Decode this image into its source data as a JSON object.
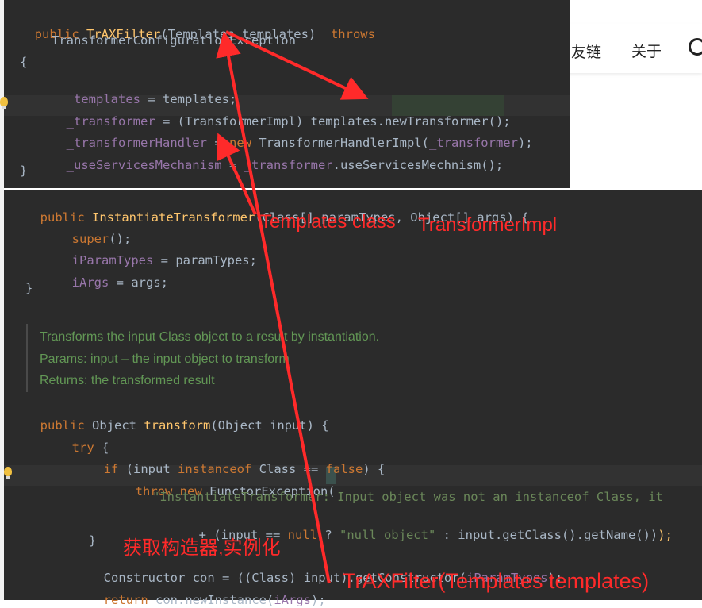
{
  "nav": {
    "link_friends": "友链",
    "link_about": "关于",
    "search_icon": "search-icon"
  },
  "top_code": {
    "line1": {
      "kw": "public ",
      "fn": "TrAXFilter",
      "rest": "(Templates templates)  ",
      "throws": "throws"
    },
    "line2": "TransformerConfigurationException",
    "line3": "{",
    "line4": {
      "fld": "_templates",
      "rest": " = templates;"
    },
    "line5": {
      "fld": "_transformer",
      "rest1": " = (TransformerImpl) templates.",
      "call": "newTransformer",
      "rest2": "();"
    },
    "line6": {
      "fld": "_transformerHandler",
      "eq": " = ",
      "kw": "new",
      "mid": " TransformerHandlerImpl(",
      "arg": "_transformer",
      "end": ");"
    },
    "line7": {
      "fld": "_useServicesMechanism",
      "eq": " = ",
      "obj": "_transformer",
      "rest": ".useServicesMechnism();"
    },
    "line8": "}"
  },
  "bottom_code": {
    "ctor": {
      "kw": "public ",
      "fn": "InstantiateTransformer",
      "rest": "(Class[] paramTypes, Object[] args) {"
    },
    "super": {
      "kw": "super",
      "rest": "();"
    },
    "ptypes": {
      "fld": "iParamTypes",
      "rest": " = paramTypes;"
    },
    "iargs": {
      "fld": "iArgs",
      "rest": " = args;"
    },
    "close1": "}",
    "doc1": "Transforms the input Class object to a result by instantiation.",
    "doc2": "Params: input – the input object to transform",
    "doc3": "Returns: the transformed result",
    "method": {
      "kw": "public ",
      "type": "Object ",
      "fn": "transform",
      "rest": "(Object input) {"
    },
    "try": {
      "kw": "try",
      "rest": " {"
    },
    "if": {
      "kw1": "if",
      "p1": " (input ",
      "kw2": "instanceof",
      "p2": " Class == ",
      "kw3": "false",
      "p3": ") {"
    },
    "throw": {
      "kw1": "throw",
      "kw2": " new",
      "rest": " FunctorException("
    },
    "msg": "\"InstantiateTransformer: Input object was not an instanceof Class, it",
    "plus": {
      "p1": "+ (input == ",
      "kw": "null",
      "p2": " ? ",
      "str": "\"null object\"",
      "p3": " : input.getClass().getName())",
      "end": ");"
    },
    "close2": "}",
    "constructor": {
      "p1": "Constructor con = ((Class) input).getConstructor(",
      "fld": "iParamTypes",
      "p2": ");"
    },
    "ret": {
      "kw": "return",
      "p1": " con.newInstance(",
      "fld": "iArgs",
      "p2": ");"
    }
  },
  "annotations": {
    "templates_class": "Templates class",
    "transformer_impl": "TransformerImpl",
    "get_constructor": "获取构造器,实例化",
    "traxfilter": "TrAXFilter(Templates templates)"
  },
  "colors": {
    "bg": "#2b2b2b",
    "keyword": "#cc7832",
    "function": "#ffc66d",
    "field": "#9876aa",
    "plain": "#a9b7c6",
    "annotation": "#ff2a2a"
  }
}
